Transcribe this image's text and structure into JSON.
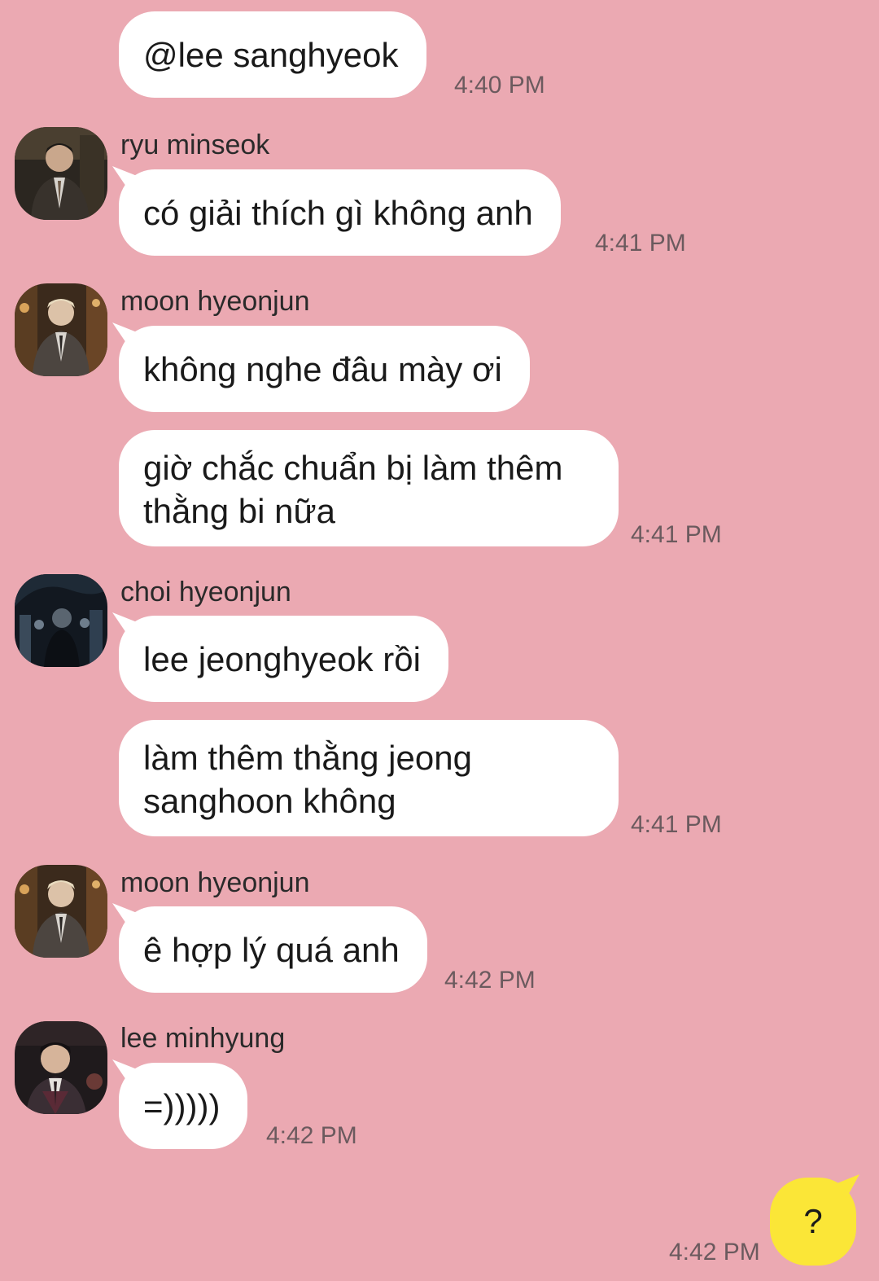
{
  "messages": [
    {
      "text": "@lee sanghyeok",
      "time": "4:40 PM"
    },
    {
      "sender": "ryu minseok",
      "avatar": "avatar-ryu-minseok",
      "text": "có giải thích gì không anh",
      "time": "4:41 PM"
    },
    {
      "sender": "moon hyeonjun",
      "avatar": "avatar-moon-hyeonjun",
      "text": "không nghe đâu mày ơi"
    },
    {
      "text": "giờ chắc chuẩn bị làm thêm thằng bi nữa",
      "time": "4:41 PM"
    },
    {
      "sender": "choi hyeonjun",
      "avatar": "avatar-choi-hyeonjun",
      "text": "lee jeonghyeok rồi"
    },
    {
      "text": "làm thêm thằng jeong sanghoon không",
      "time": "4:41 PM"
    },
    {
      "sender": "moon hyeonjun",
      "avatar": "avatar-moon-hyeonjun",
      "text": "ê hợp lý quá anh",
      "time": "4:42 PM"
    },
    {
      "sender": "lee minhyung",
      "avatar": "avatar-lee-minhyung",
      "text": "=)))))",
      "time": "4:42 PM"
    }
  ],
  "my_message": {
    "text": "?",
    "time": "4:42 PM"
  },
  "colors": {
    "background": "#eba9b2",
    "incoming_bubble": "#ffffff",
    "outgoing_bubble": "#fbe637",
    "timestamp": "#6b5a5e"
  }
}
